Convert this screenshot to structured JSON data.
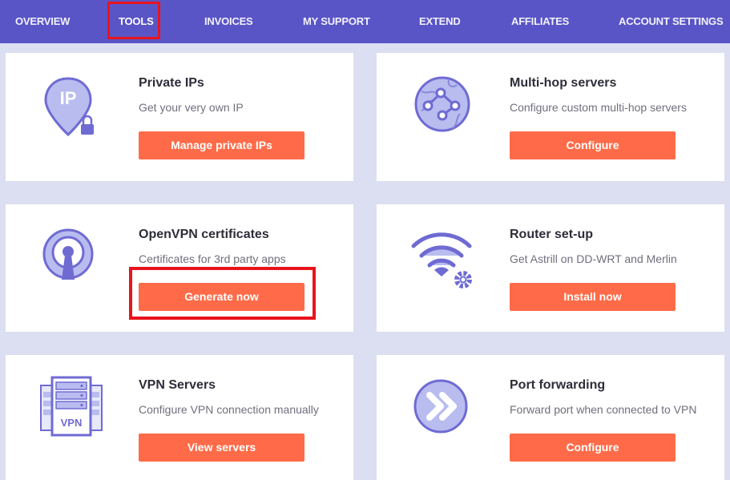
{
  "nav": {
    "items": [
      {
        "label": "OVERVIEW"
      },
      {
        "label": "TOOLS"
      },
      {
        "label": "INVOICES"
      },
      {
        "label": "MY SUPPORT"
      },
      {
        "label": "EXTEND"
      },
      {
        "label": "AFFILIATES"
      },
      {
        "label": "ACCOUNT SETTINGS"
      }
    ],
    "active": "TOOLS"
  },
  "tools": [
    {
      "title": "Private IPs",
      "description": "Get your very own IP",
      "button": "Manage private IPs",
      "icon": "map-pin-ip-lock-icon",
      "icon_text": "IP"
    },
    {
      "title": "Multi-hop servers",
      "description": "Configure custom multi-hop servers",
      "button": "Configure",
      "icon": "globe-network-icon"
    },
    {
      "title": "OpenVPN certificates",
      "description": "Certificates for 3rd party apps",
      "button": "Generate now",
      "icon": "openvpn-icon"
    },
    {
      "title": "Router set-up",
      "description": "Get Astrill on DD-WRT and Merlin",
      "button": "Install now",
      "icon": "wifi-gear-icon"
    },
    {
      "title": "VPN Servers",
      "description": "Configure VPN connection manually",
      "button": "View servers",
      "icon": "server-rack-icon",
      "icon_text": "VPN"
    },
    {
      "title": "Port forwarding",
      "description": "Forward port when connected to VPN",
      "button": "Configure",
      "icon": "double-chevron-icon"
    }
  ],
  "colors": {
    "nav_bg": "#5a55c6",
    "page_bg": "#dcdff2",
    "button_bg": "#ff6b48",
    "icon_primary": "#6f6bd3",
    "icon_light": "#b9bcef",
    "highlight": "#e8141c"
  }
}
